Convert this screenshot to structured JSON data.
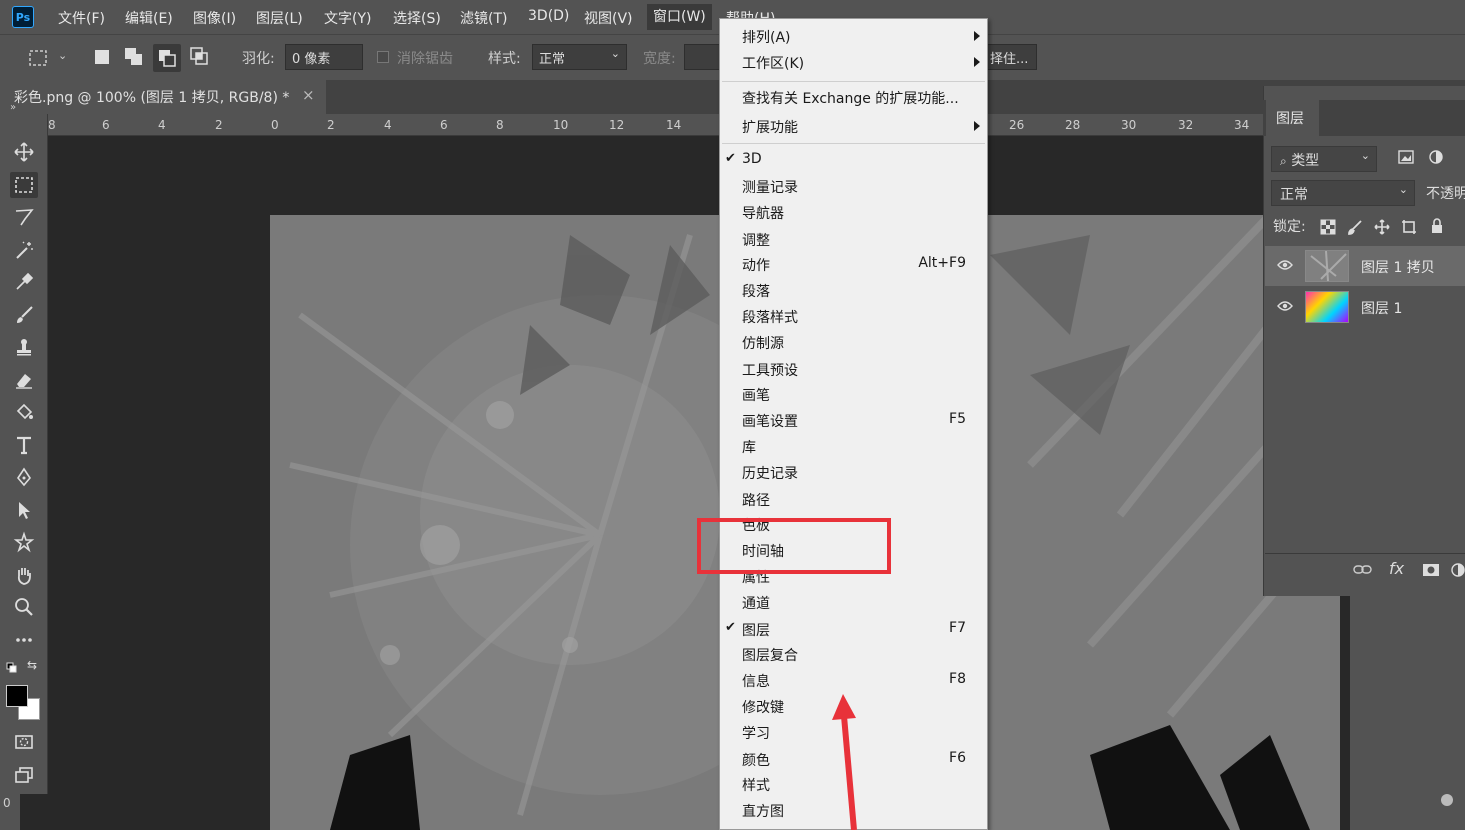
{
  "app": {
    "logo": "Ps"
  },
  "menubar": {
    "items": [
      "文件(F)",
      "编辑(E)",
      "图像(I)",
      "图层(L)",
      "文字(Y)",
      "选择(S)",
      "滤镜(T)",
      "3D(D)",
      "视图(V)",
      "窗口(W)",
      "帮助(H)"
    ]
  },
  "options": {
    "feather_label": "羽化:",
    "feather_value": "0 像素",
    "antialias_label": "消除锯齿",
    "style_label": "样式:",
    "style_value": "正常",
    "width_label": "宽度:",
    "right_btn": "择住..."
  },
  "document": {
    "tab_title": "彩色.png @ 100% (图层 1 拷贝, RGB/8) *",
    "close": "×"
  },
  "ruler": {
    "ticks": [
      "8",
      "6",
      "4",
      "2",
      "0",
      "2",
      "4",
      "6",
      "8",
      "10",
      "12",
      "14",
      "26",
      "28",
      "30",
      "32",
      "34"
    ],
    "left_tick": "0"
  },
  "window_menu": {
    "items": [
      {
        "label": "排列(A)",
        "submenu": true
      },
      {
        "label": "工作区(K)",
        "submenu": true
      },
      {
        "label": "查找有关 Exchange 的扩展功能..."
      },
      {
        "label": "扩展功能",
        "submenu": true
      },
      {
        "label": "3D",
        "checked": true
      },
      {
        "label": "测量记录"
      },
      {
        "label": "导航器"
      },
      {
        "label": "调整"
      },
      {
        "label": "动作",
        "shortcut": "Alt+F9"
      },
      {
        "label": "段落"
      },
      {
        "label": "段落样式"
      },
      {
        "label": "仿制源"
      },
      {
        "label": "工具预设"
      },
      {
        "label": "画笔"
      },
      {
        "label": "画笔设置",
        "shortcut": "F5"
      },
      {
        "label": "库"
      },
      {
        "label": "历史记录"
      },
      {
        "label": "路径"
      },
      {
        "label": "色板"
      },
      {
        "label": "时间轴"
      },
      {
        "label": "属性"
      },
      {
        "label": "通道"
      },
      {
        "label": "图层",
        "checked": true,
        "shortcut": "F7"
      },
      {
        "label": "图层复合"
      },
      {
        "label": "信息",
        "shortcut": "F8"
      },
      {
        "label": "修改键"
      },
      {
        "label": "学习"
      },
      {
        "label": "颜色",
        "shortcut": "F6"
      },
      {
        "label": "样式"
      },
      {
        "label": "直方图"
      }
    ]
  },
  "layers_panel": {
    "tab": "图层",
    "filter_label": "类型",
    "blend_mode": "正常",
    "opacity_label": "不透明",
    "lock_label": "锁定:",
    "layers": [
      {
        "name": "图层 1 拷贝",
        "selected": true
      },
      {
        "name": "图层 1",
        "selected": false
      }
    ],
    "fx_label": "fx"
  },
  "colors": {
    "menu_bg": "#f0f0f0",
    "highlight": "#e8323a",
    "chrome": "#535353"
  }
}
